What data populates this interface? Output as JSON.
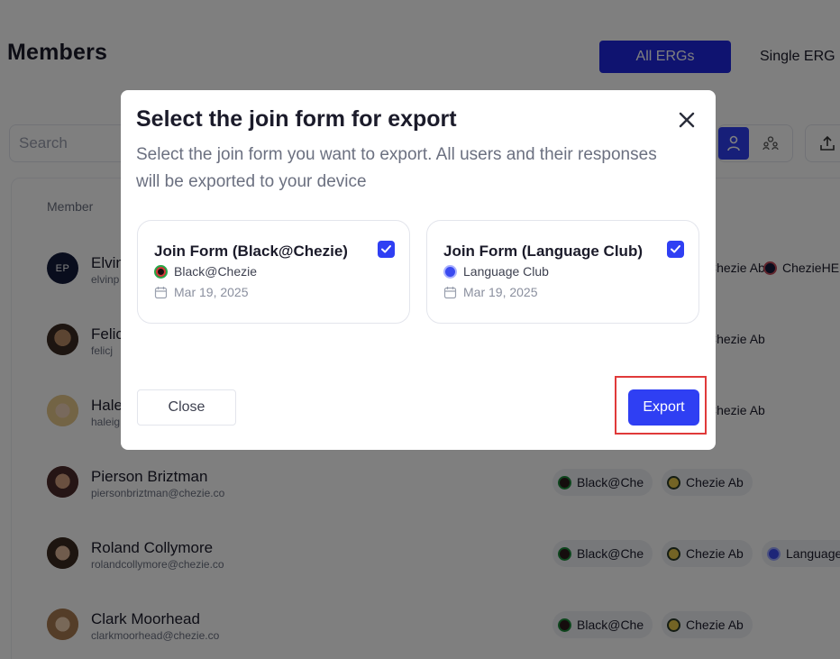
{
  "page": {
    "title": "Members",
    "segment": {
      "all_label": "All ERGs",
      "single_label": "Single ERG"
    },
    "search": {
      "placeholder": "Search"
    },
    "table": {
      "column_member": "Member"
    },
    "members": [
      {
        "name": "Elvin",
        "email": "elvinp",
        "initials": "EP",
        "chips": [
          "Chezie Ab",
          "ChezieHE"
        ]
      },
      {
        "name": "Felic",
        "email": "felicj",
        "chips": [
          "Chezie Ab"
        ]
      },
      {
        "name": "Hale",
        "email": "haleig",
        "chips": [
          "Chezie Ab"
        ]
      },
      {
        "name": "Pierson Briztman",
        "email": "piersonbriztman@chezie.co",
        "chips": [
          "Black@Che",
          "Chezie Ab"
        ]
      },
      {
        "name": "Roland Collymore",
        "email": "rolandcollymore@chezie.co",
        "chips": [
          "Black@Che",
          "Chezie Ab",
          "Language"
        ]
      },
      {
        "name": "Clark Moorhead",
        "email": "clarkmoorhead@chezie.co",
        "chips": [
          "Black@Che",
          "Chezie Ab"
        ]
      }
    ]
  },
  "modal": {
    "title": "Select the join form for export",
    "description": "Select the join form you want to export. All users and their responses will be exported to your device",
    "forms": [
      {
        "title": "Join Form (Black@Chezie)",
        "erg": "Black@Chezie",
        "date": "Mar 19, 2025",
        "checked": true
      },
      {
        "title": "Join Form (Language Club)",
        "erg": "Language Club",
        "date": "Mar 19, 2025",
        "checked": true
      }
    ],
    "close_label": "Close",
    "export_label": "Export"
  },
  "colors": {
    "primary": "#2f3ff3",
    "segment_active": "#1f26e0",
    "highlight": "#e03a3a",
    "overlay": "rgba(0,0,0,0.5)"
  },
  "icons": {
    "close": "close-icon",
    "checkbox": "checkmark-icon",
    "calendar": "calendar-icon",
    "person": "person-icon",
    "group": "group-icon",
    "upload": "upload-icon"
  }
}
